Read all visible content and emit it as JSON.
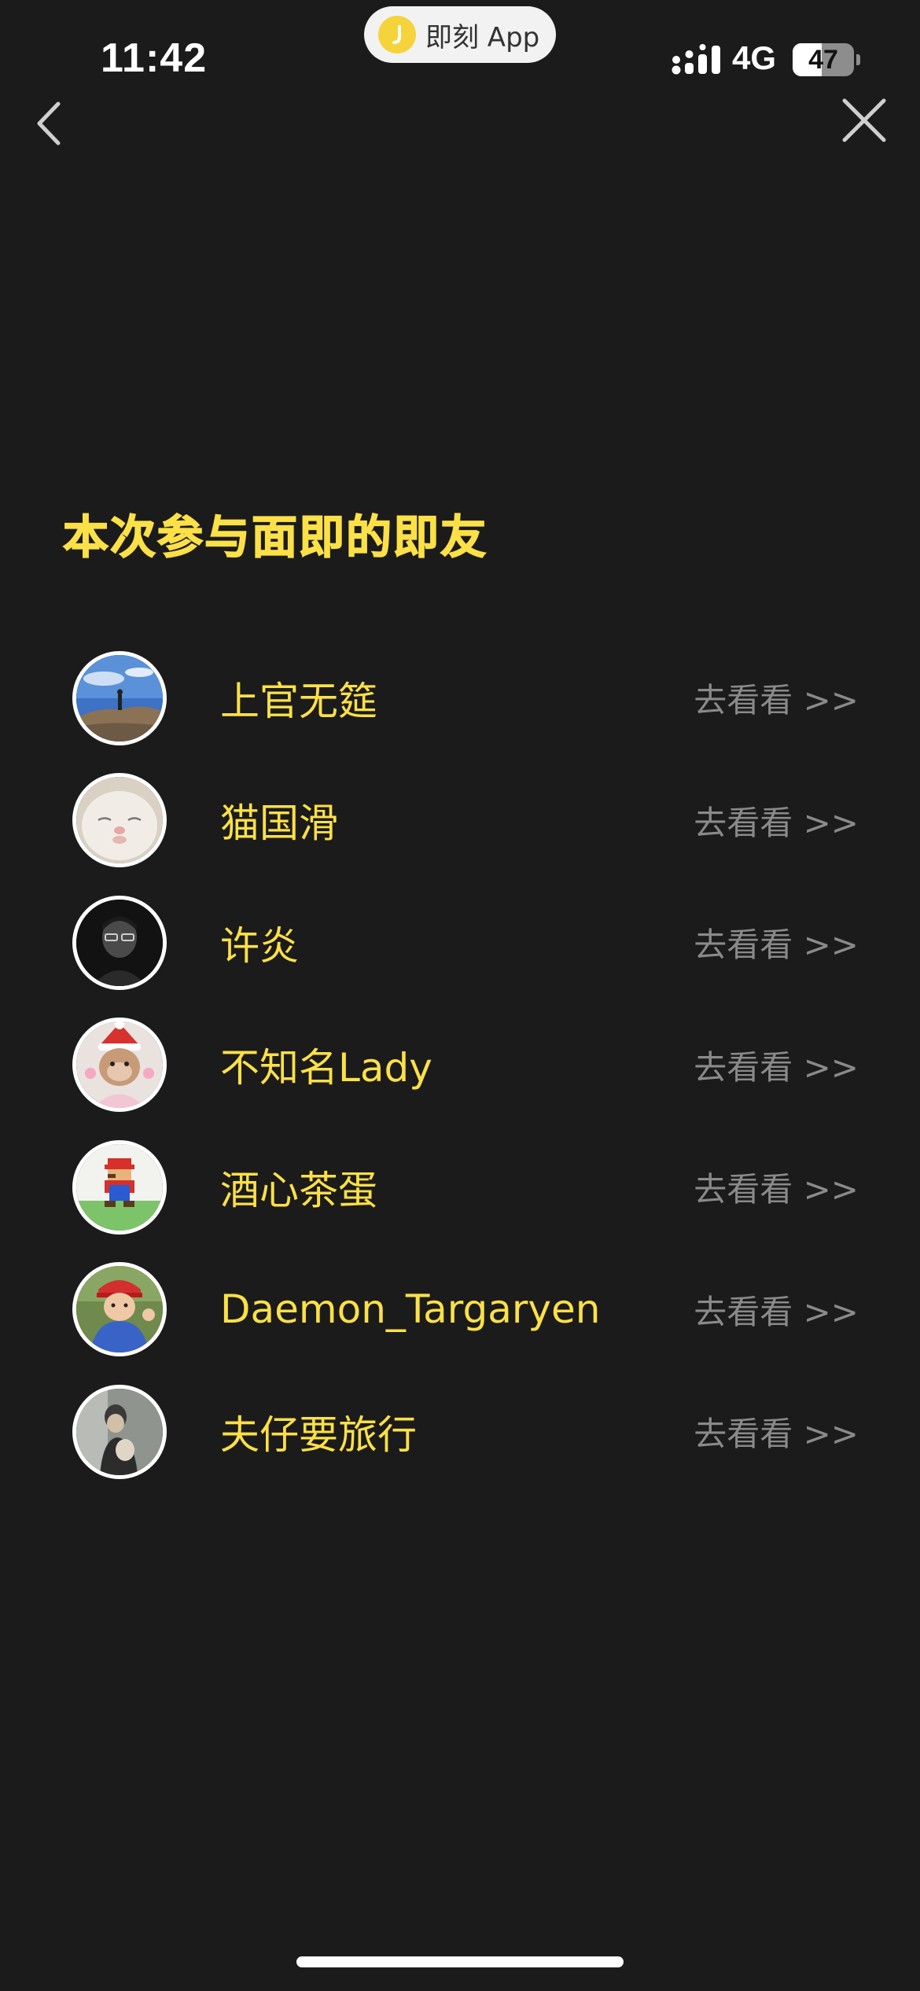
{
  "status_bar": {
    "time": "11:42",
    "app_pill_label": "即刻 App",
    "network": "4G",
    "battery_level": "47",
    "battery_fraction": 0.47
  },
  "section_title": "本次参与面即的即友",
  "participants": [
    {
      "name": "上官无筵",
      "action": "去看看 >>"
    },
    {
      "name": "猫国滑",
      "action": "去看看 >>"
    },
    {
      "name": "许炎",
      "action": "去看看 >>"
    },
    {
      "name": "不知名Lady",
      "action": "去看看 >>"
    },
    {
      "name": "酒心茶蛋",
      "action": "去看看 >>"
    },
    {
      "name": "Daemon_Targaryen",
      "action": "去看看 >>"
    },
    {
      "name": "夫仔要旅行",
      "action": "去看看 >>"
    }
  ],
  "colors": {
    "background": "#1b1b1b",
    "accent_yellow": "#fbe047",
    "secondary_gray": "#8a8a8a"
  },
  "icons": {
    "back": "chevron-left-icon",
    "close": "close-icon",
    "app": "jike-logo-icon",
    "signal": "signal-dots-icon",
    "battery": "battery-icon"
  }
}
